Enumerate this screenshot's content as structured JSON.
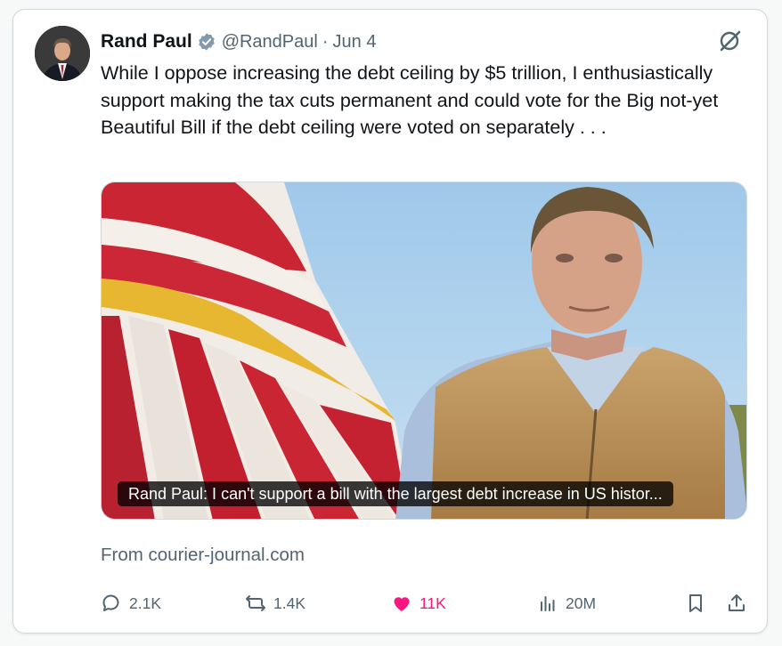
{
  "post": {
    "author_name": "Rand Paul",
    "handle": "@RandPaul",
    "separator": "·",
    "date": "Jun 4",
    "text": "While I oppose increasing the debt ceiling by $5 trillion, I enthusiastically support making the tax cuts permanent and could vote for the Big not-yet Beautiful Bill if the debt ceiling were voted on separately . . .",
    "link_card": {
      "caption": "Rand Paul: I can't support a bill with the largest debt increase in US histor...",
      "source": "From courier-journal.com"
    }
  },
  "actions": {
    "replies": "2.1K",
    "reposts": "1.4K",
    "likes": "11K",
    "views": "20M"
  },
  "icons": {
    "verified": "verified-badge-icon",
    "grok": "grok-icon",
    "reply": "reply-icon",
    "repost": "repost-icon",
    "like": "heart-icon",
    "views": "views-chart-icon",
    "bookmark": "bookmark-icon",
    "share": "share-icon"
  },
  "colors": {
    "like_active": "#f91880",
    "secondary_text": "#536471",
    "verified": "#829aab"
  }
}
